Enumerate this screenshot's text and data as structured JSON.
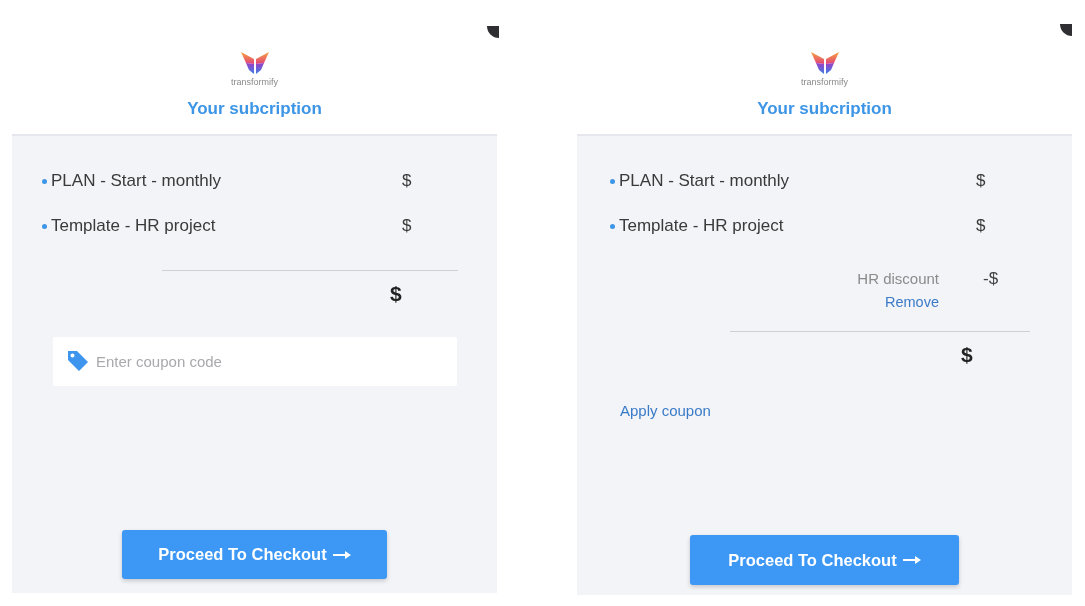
{
  "panels": [
    {
      "logo_text": "transformify",
      "title": "Your subcription",
      "items": [
        {
          "label": "PLAN - Start - monthly",
          "price": "$"
        },
        {
          "label": "Template - HR project",
          "price": "$"
        }
      ],
      "total": "$",
      "coupon": {
        "kind": "field",
        "placeholder": "Enter coupon code"
      },
      "checkout_button": "Proceed To Checkout"
    },
    {
      "logo_text": "transformify",
      "title": "Your subcription",
      "items": [
        {
          "label": "PLAN - Start - monthly",
          "price": "$"
        },
        {
          "label": "Template - HR project",
          "price": "$"
        }
      ],
      "discounts": [
        {
          "label": "HR discount",
          "amount": "-$",
          "action": "Remove"
        }
      ],
      "total": "$",
      "coupon": {
        "kind": "link",
        "label": "Apply coupon"
      },
      "checkout_button": "Proceed To Checkout"
    }
  ]
}
